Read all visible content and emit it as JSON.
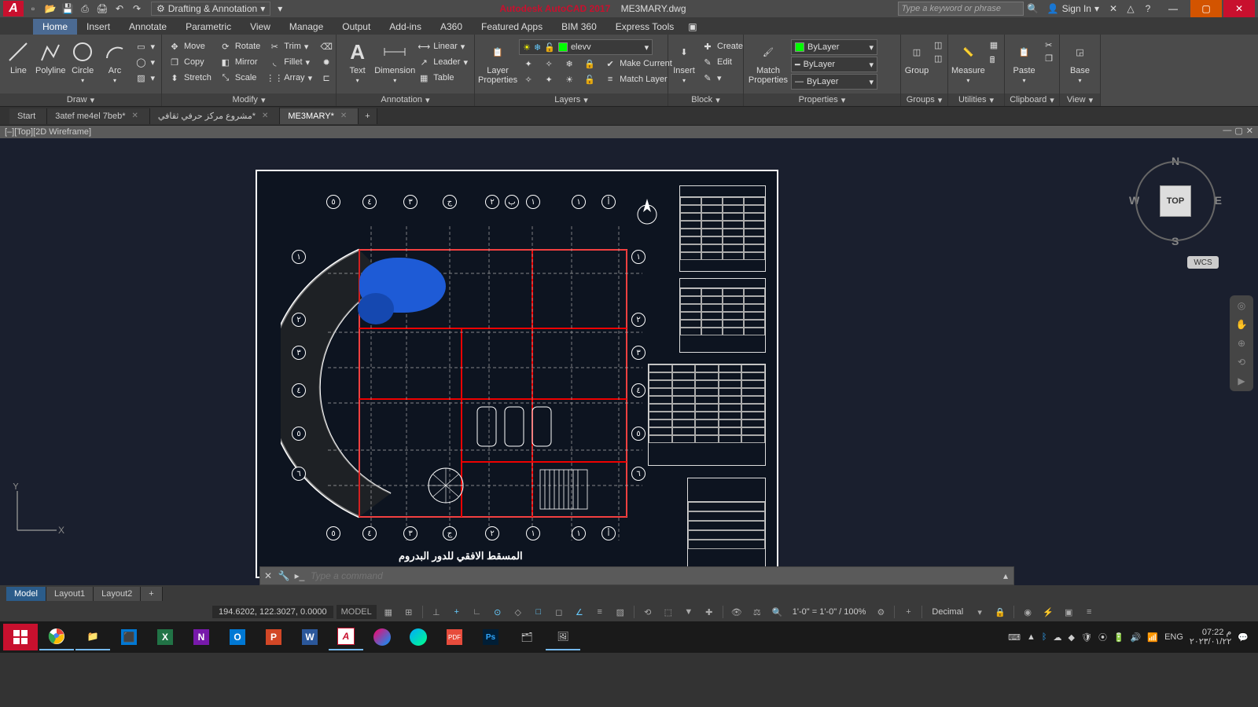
{
  "titlebar": {
    "app_name": "Autodesk AutoCAD 2017",
    "doc_name": "ME3MARY.dwg",
    "workspace": "Drafting & Annotation",
    "search_placeholder": "Type a keyword or phrase",
    "signin": "Sign In"
  },
  "ribbon_tabs": [
    "Home",
    "Insert",
    "Annotate",
    "Parametric",
    "View",
    "Manage",
    "Output",
    "Add-ins",
    "A360",
    "Featured Apps",
    "BIM 360",
    "Express Tools"
  ],
  "ribbon": {
    "draw": {
      "title": "Draw",
      "line": "Line",
      "polyline": "Polyline",
      "circle": "Circle",
      "arc": "Arc"
    },
    "modify": {
      "title": "Modify",
      "move": "Move",
      "rotate": "Rotate",
      "trim": "Trim",
      "copy": "Copy",
      "mirror": "Mirror",
      "fillet": "Fillet",
      "stretch": "Stretch",
      "scale": "Scale",
      "array": "Array"
    },
    "annotation": {
      "title": "Annotation",
      "text": "Text",
      "dimension": "Dimension",
      "linear": "Linear",
      "leader": "Leader",
      "table": "Table"
    },
    "layers": {
      "title": "Layers",
      "layer_props": "Layer Properties",
      "current_layer": "elevv",
      "make_current": "Make Current",
      "match_layer": "Match Layer"
    },
    "block": {
      "title": "Block",
      "insert": "Insert",
      "create": "Create",
      "edit": "Edit"
    },
    "properties": {
      "title": "Properties",
      "match": "Match Properties",
      "color": "ByLayer",
      "lweight": "ByLayer",
      "ltype": "ByLayer"
    },
    "groups": {
      "title": "Groups",
      "group": "Group"
    },
    "utilities": {
      "title": "Utilities",
      "measure": "Measure"
    },
    "clipboard": {
      "title": "Clipboard",
      "paste": "Paste"
    },
    "view": {
      "title": "View",
      "base": "Base"
    }
  },
  "file_tabs": [
    {
      "label": "Start",
      "active": false,
      "closable": false
    },
    {
      "label": "3atef me4el 7beb*",
      "active": false,
      "closable": true
    },
    {
      "label": "مشروع مركز حرفي ثقافي*",
      "active": false,
      "closable": true
    },
    {
      "label": "ME3MARY*",
      "active": true,
      "closable": true
    }
  ],
  "viewport_label": "[–][Top][2D Wireframe]",
  "viewcube": {
    "top": "TOP",
    "n": "N",
    "e": "E",
    "s": "S",
    "w": "W",
    "wcs": "WCS"
  },
  "drawing_title": "المسقط الافقي للدور البدروم",
  "command_placeholder": "Type a command",
  "layout_tabs": [
    "Model",
    "Layout1",
    "Layout2"
  ],
  "status": {
    "coords": "194.6202, 122.3027, 0.0000",
    "model": "MODEL",
    "scale": "1'-0\" = 1'-0\" / 100%",
    "units": "Decimal"
  },
  "tray": {
    "lang": "ENG",
    "time": "07:22 م",
    "date": "٢٠٢٣/٠١/٢٢"
  }
}
